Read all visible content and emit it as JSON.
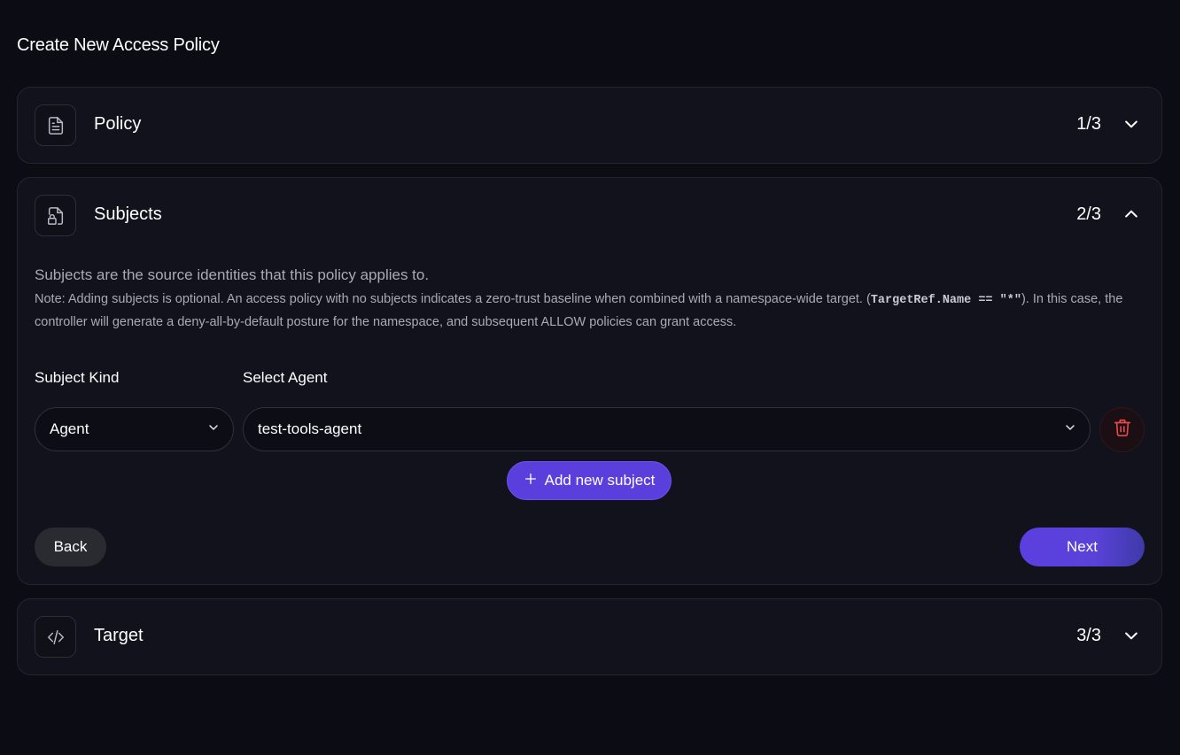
{
  "page": {
    "title": "Create New Access Policy"
  },
  "sections": {
    "policy": {
      "title": "Policy",
      "step": "1/3",
      "icon": "document-icon",
      "expanded": false
    },
    "subjects": {
      "title": "Subjects",
      "step": "2/3",
      "icon": "file-lock-icon",
      "expanded": true,
      "description": "Subjects are the source identities that this policy applies to.",
      "note_prefix": "Note: Adding subjects is optional. An access policy with no subjects indicates a zero-trust baseline when combined with a namespace-wide target. (",
      "note_code": "TargetRef.Name == \"*\"",
      "note_suffix": "). In this case, the controller will generate a deny-all-by-default posture for the namespace, and subsequent ALLOW policies can grant access.",
      "subject_kind_label": "Subject Kind",
      "select_agent_label": "Select Agent",
      "subject_kind_value": "Agent",
      "select_agent_value": "test-tools-agent",
      "add_button": "Add new subject",
      "back_button": "Back",
      "next_button": "Next"
    },
    "target": {
      "title": "Target",
      "step": "3/3",
      "icon": "code-icon",
      "expanded": false
    }
  },
  "colors": {
    "accent": "#5a3fdc",
    "danger": "#e5484d",
    "background": "#0c0d14",
    "card": "#11121b"
  }
}
